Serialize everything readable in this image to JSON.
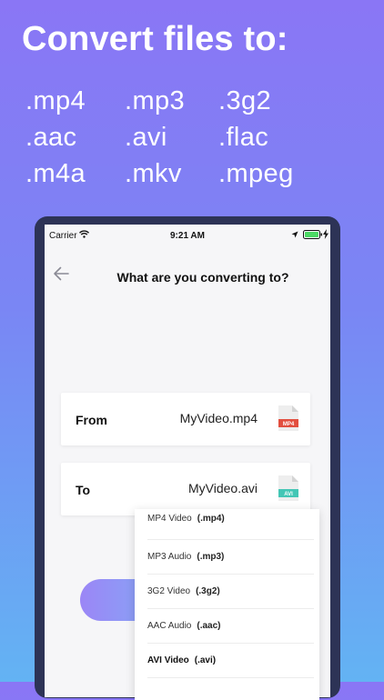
{
  "promo": {
    "headline": "Convert files to:",
    "formats": [
      ".mp4",
      ".mp3",
      ".3g2",
      ".aac",
      ".avi",
      ".flac",
      ".m4a",
      ".mkv",
      ".mpeg"
    ]
  },
  "status_bar": {
    "carrier": "Carrier",
    "time": "9:21 AM"
  },
  "nav": {
    "title": "What are you converting to?"
  },
  "from_card": {
    "label": "From",
    "filename": "MyVideo.mp4",
    "badge": "MP4"
  },
  "to_card": {
    "label": "To",
    "filename": "MyVideo.avi",
    "badge": "AVI"
  },
  "dropdown": {
    "items": [
      {
        "name": "MP4 Video",
        "ext": "(.mp4)"
      },
      {
        "name": "MP3 Audio",
        "ext": "(.mp3)"
      },
      {
        "name": "3G2 Video",
        "ext": "(.3g2)"
      },
      {
        "name": "AAC Audio",
        "ext": "(.aac)"
      },
      {
        "name": "AVI Video",
        "ext": "(.avi)"
      }
    ],
    "selected_index": 4
  },
  "colors": {
    "gradient_top": "#8a76f5",
    "gradient_bottom": "#63b3f3",
    "device_frame": "#2d3356",
    "mp4_badge": "#e24f3f",
    "avi_badge": "#44c6b5"
  }
}
